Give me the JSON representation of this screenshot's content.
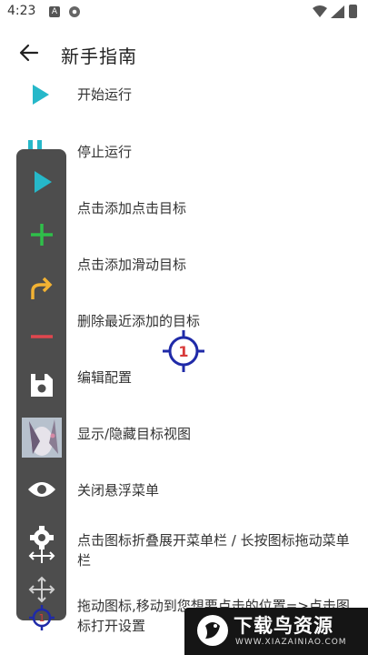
{
  "status_bar": {
    "time": "4:23",
    "a_glyph": "A"
  },
  "app_bar": {
    "title": "新手指南"
  },
  "rows": [
    {
      "label": "开始运行",
      "icon": "play-icon"
    },
    {
      "label": "停止运行",
      "icon": "pause-icon"
    },
    {
      "label": "点击添加点击目标",
      "icon": "plus-icon"
    },
    {
      "label": "点击添加滑动目标",
      "icon": "swipe-arrow-icon"
    },
    {
      "label": "删除最近添加的目标",
      "icon": "minus-icon"
    },
    {
      "label": "编辑配置",
      "icon": "config-icon"
    },
    {
      "label": "显示/隐藏目标视图",
      "icon": "thumbnail-image"
    },
    {
      "label": "关闭悬浮菜单",
      "icon": "eye-icon"
    },
    {
      "label": "点击图标折叠展开菜单栏 / 长按图标拖动菜单栏",
      "icon": "gear-move-icon"
    },
    {
      "label": "拖动图标,移动到您想要点击的位置=>点击图标打开设置",
      "icon": "target-icon"
    }
  ],
  "target_marker": {
    "number": "1"
  },
  "float_menu_target": {
    "number": "1"
  },
  "watermark": {
    "title": "下载鸟资源",
    "subtitle": "WWW.XIAZAINIAO.COM"
  },
  "colors": {
    "play": "#26b8c9",
    "plus": "#2fbf4a",
    "swipe": "#f2b233",
    "minus": "#e0464e",
    "target": "#1f2aa8",
    "target_number": "#d83a3a",
    "menu_bg": "#4d4d4d"
  }
}
